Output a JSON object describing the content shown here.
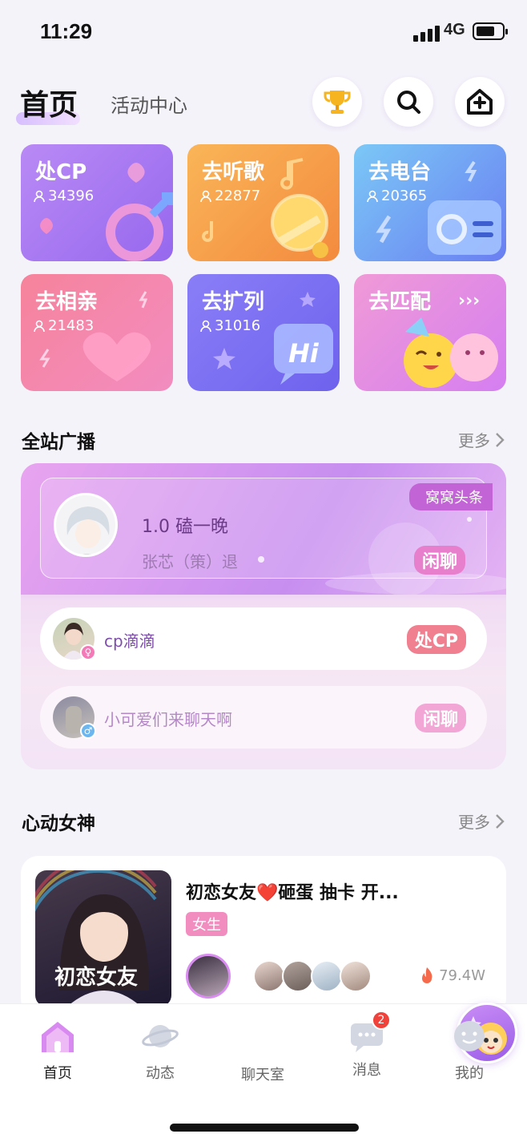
{
  "status": {
    "time": "11:29",
    "network": "4G"
  },
  "header": {
    "title": "首页",
    "subtitle": "活动中心"
  },
  "categories": [
    {
      "title": "处CP",
      "count": "34396"
    },
    {
      "title": "去听歌",
      "count": "22877"
    },
    {
      "title": "去电台",
      "count": "20365"
    },
    {
      "title": "去相亲",
      "count": "21483"
    },
    {
      "title": "去扩列",
      "count": "31016"
    },
    {
      "title": "去匹配",
      "count": ""
    }
  ],
  "broadcast": {
    "title": "全站广播",
    "more": "更多",
    "headline_tag": "窝窝头条",
    "headline": {
      "name": "1.0 磕一晚",
      "sub": "张芯（策）退",
      "chip": "闲聊"
    },
    "rows": [
      {
        "text": "cp滴滴",
        "chip": "处CP"
      },
      {
        "text": "小可爱们来聊天啊",
        "chip": "闲聊"
      }
    ]
  },
  "goddess": {
    "title": "心动女神",
    "more": "更多",
    "card": {
      "room_title": "初恋女友❤️砸蛋 抽卡 开...",
      "badge": "女生",
      "image_text": "初恋女友",
      "heat": "79.4W"
    }
  },
  "nav": {
    "items": [
      "首页",
      "动态",
      "聊天室",
      "消息",
      "我的"
    ],
    "message_badge": "2"
  },
  "colors": {
    "accent": "#c264d6",
    "purple_text": "#7d4ea8"
  }
}
